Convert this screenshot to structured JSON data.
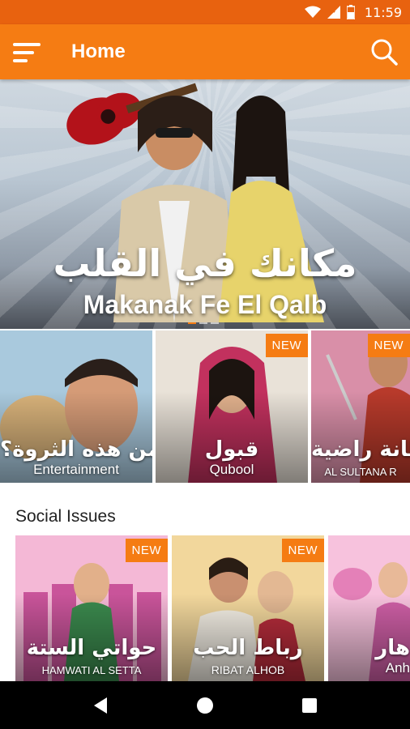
{
  "status_bar": {
    "time": "11:59"
  },
  "app_bar": {
    "title": "Home"
  },
  "hero": {
    "title_arabic": "مكانك في القلب",
    "title_latin": "Makanak Fe El Qalb"
  },
  "featured_row": [
    {
      "title_arabic": "لمن هذه الثروة؟",
      "subtitle": "Entertainment",
      "badge": "",
      "colors": [
        "#a9c9dd",
        "#6f8fa8"
      ]
    },
    {
      "title_arabic": "قبول",
      "subtitle": "Qubool",
      "badge": "NEW",
      "colors": [
        "#e9e2d8",
        "#c5a9b0"
      ]
    },
    {
      "title_arabic": "سلطانة راضية",
      "subtitle": "AL SULTANA R",
      "badge": "NEW",
      "colors": [
        "#d98fa8",
        "#8a3b57"
      ]
    }
  ],
  "social_section": {
    "title": "Social Issues",
    "items": [
      {
        "title_arabic": "حواتي الستة",
        "subtitle": "HAMWATI AL SETTA",
        "badge": "NEW",
        "colors": [
          "#f4b8d6",
          "#c9549a"
        ]
      },
      {
        "title_arabic": "رباط الحب",
        "subtitle": "RIBAT ALHOB",
        "badge": "NEW",
        "colors": [
          "#f2d79c",
          "#b47a2e"
        ]
      },
      {
        "title_arabic": "هار",
        "subtitle": "Anh",
        "badge": "",
        "colors": [
          "#f7c2dd",
          "#cf5fa6"
        ]
      }
    ]
  }
}
